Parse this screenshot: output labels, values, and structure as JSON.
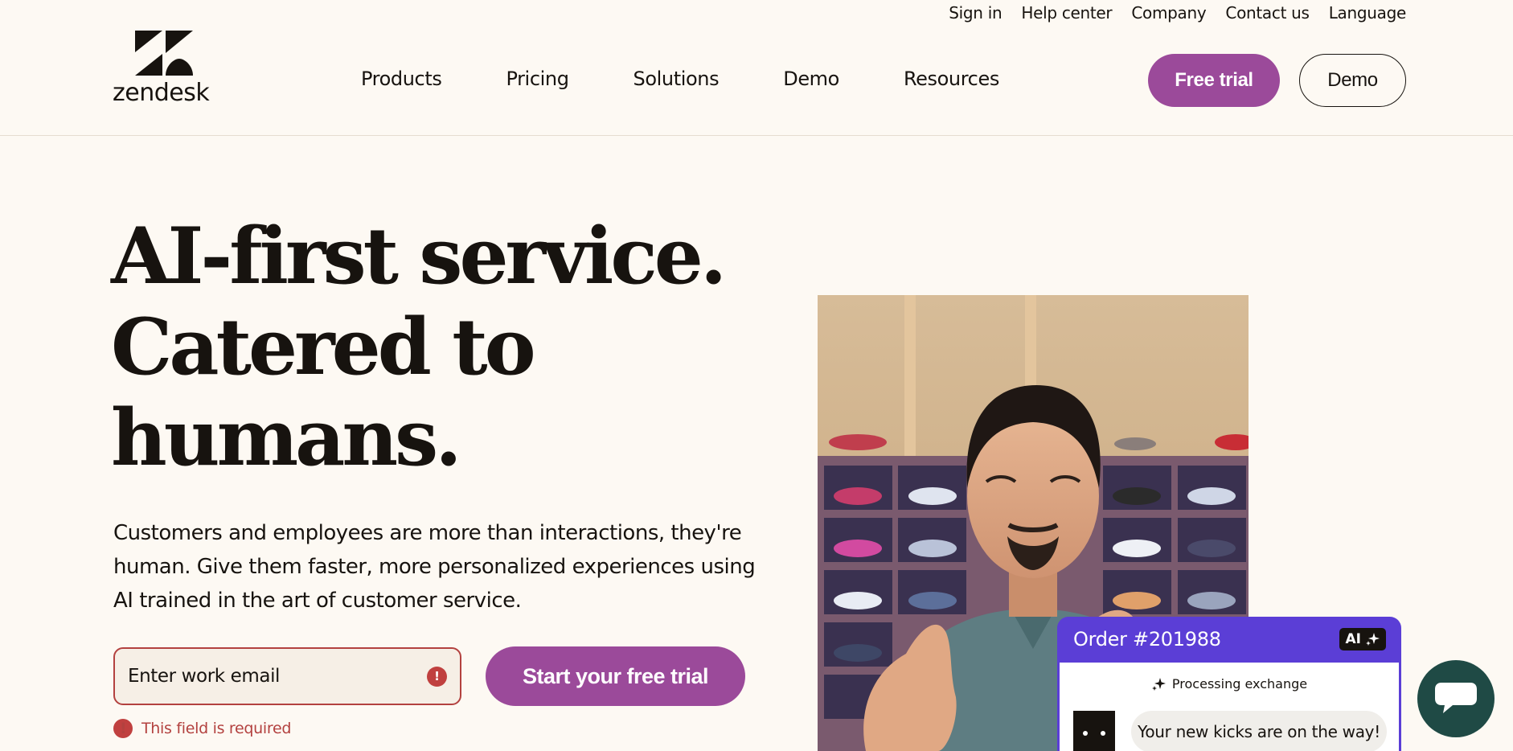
{
  "utility_nav": [
    "Sign in",
    "Help center",
    "Company",
    "Contact us",
    "Language"
  ],
  "brand": {
    "name": "zendesk",
    "accent": "#9b4a9a",
    "error": "#b3413f"
  },
  "nav": [
    "Products",
    "Pricing",
    "Solutions",
    "Demo",
    "Resources"
  ],
  "header_buttons": {
    "trial": "Free trial",
    "demo": "Demo"
  },
  "hero": {
    "headline": [
      "AI-first service.",
      "Catered to",
      "humans."
    ],
    "subtext": "Customers and employees are more than interactions, they're human. Give them faster, more personalized experiences using AI trained in the art of customer service.",
    "email_placeholder": "Enter work email",
    "cta": "Start your free trial",
    "error_text": "This field is required",
    "error_icon": "!"
  },
  "order_card": {
    "title": "Order #201988",
    "badge": "AI",
    "status": "Processing exchange",
    "message": "Your new kicks are on the way!"
  }
}
